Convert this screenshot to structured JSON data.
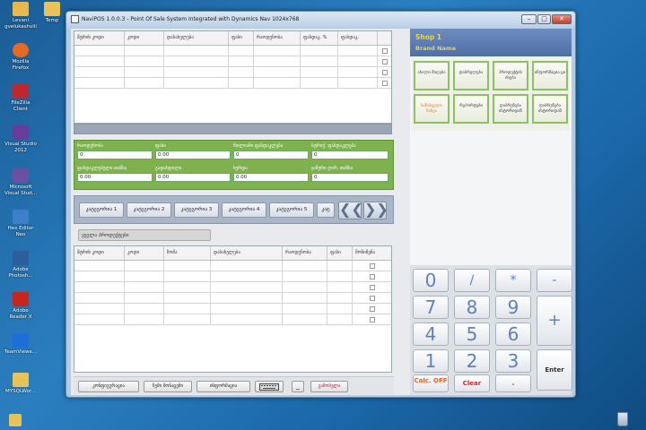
{
  "desktop": {
    "icons": [
      {
        "label1": "Levani",
        "label2": "gvelukashvili",
        "color": "#e8b84a"
      },
      {
        "label1": "Temp",
        "label2": "",
        "color": "#e8c35a"
      },
      {
        "label1": "Mozilla",
        "label2": "Firefox",
        "color": "#e66a1f"
      },
      {
        "label1": "FileZilla",
        "label2": "Client",
        "color": "#c0262d"
      },
      {
        "label1": "Visual Studio",
        "label2": "2012",
        "color": "#6a3c9c"
      },
      {
        "label1": "Microsoft",
        "label2": "Visual Stud...",
        "color": "#6b4fa1"
      },
      {
        "label1": "Hex Editor",
        "label2": "Neo",
        "color": "#3d7fc8"
      },
      {
        "label1": "Adobe",
        "label2": "Photosh...",
        "color": "#2b5e9a"
      },
      {
        "label1": "Adobe",
        "label2": "Reader X",
        "color": "#c8261c"
      },
      {
        "label1": "TeamViewe...",
        "label2": "",
        "color": "#1d6ed8"
      },
      {
        "label1": "MYSQLWor...",
        "label2": "",
        "color": "#e8c35a"
      }
    ]
  },
  "window": {
    "title": "NaviPOS 1.0.0.3 - Point Of Sale System Integrated with Dynamics Nav 1024x768",
    "min": "–",
    "max": "□",
    "close": "✕"
  },
  "top_table": {
    "headers": [
      "შტრიხ კოდი",
      "კოდი",
      "დასახელება",
      "ფასი",
      "რაოდენობა",
      "ფასდაკ. %",
      "ფასდაკ."
    ],
    "rows": 4
  },
  "fields": {
    "quantity_label": "რაოდენობა",
    "quantity_value": "0",
    "price_label": "ფასი",
    "price_value": "0.00",
    "total_discount_label": "მთლიანი ფასდაკლება",
    "total_discount_value": "0",
    "discount_pct_label": "სტრიქ. ფასდაკლება",
    "discount_pct_value": "0",
    "discount_amount_label": "ფასდაკლებული თანხა",
    "discount_amount_value": "0.00",
    "paid_label": "გადახდილი",
    "paid_value": "0.00",
    "change_label": "ხურდა",
    "change_value": "0.00",
    "total_label": "ჯამური ღირ. თანხა",
    "total_value": "0"
  },
  "categories": {
    "items": [
      "კატეგორია 1",
      "კატეგორია 2",
      "კატეგორია 3",
      "კატეგორია 4",
      "კატეგორია 5",
      "კატ"
    ],
    "prev": "❮❮",
    "next": "❯❯"
  },
  "all_products_label": "ყველა პროდუქტები",
  "bottom_table": {
    "headers": [
      "შტრიხ კოდი",
      "კოდი",
      "ზომა",
      "დასახელება",
      "რაოდენობა",
      "ფასი",
      "მონიშვნა"
    ],
    "rows": 6
  },
  "bottom_bar": {
    "config": "კონფიგურაცია",
    "my_data": "ჩემი მონაცემი",
    "info": "ინფორმაცია",
    "keyboard_icon": "keyboard-icon",
    "minimize": "_",
    "exit": "გამოსვლა"
  },
  "shop": {
    "name": "Shop 1",
    "brand": "Brand Name",
    "name_color": "#f2d13a"
  },
  "functions": [
    "ახალი მიღება",
    "დასრულება",
    "პროდუქტის ძიება",
    "ინფორმაცია ცი",
    "სანახველი ნახვა",
    "რეპორტები",
    "დაბრუნება ისტორიდან",
    "დაბრუნება ისტორიდან"
  ],
  "keypad": {
    "digits": [
      "0",
      "7",
      "8",
      "9",
      "4",
      "5",
      "6",
      "1",
      "2",
      "3"
    ],
    "ops": [
      "/",
      "*",
      "-",
      "+"
    ],
    "calc": "Calc. OFF",
    "clear": "Clear",
    "enter": "Enter",
    "dot": "."
  }
}
